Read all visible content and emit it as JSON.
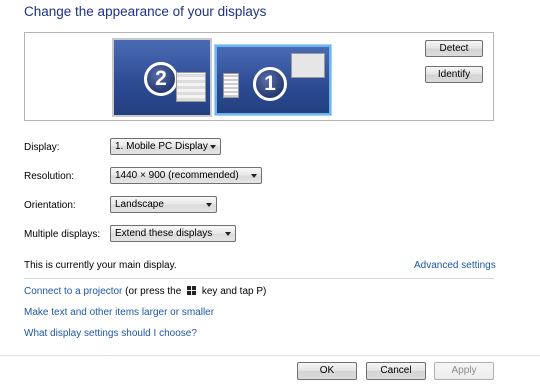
{
  "title": "Change the appearance of your displays",
  "monitors": [
    {
      "number": "2"
    },
    {
      "number": "1"
    }
  ],
  "buttons": {
    "detect": "Detect",
    "identify": "Identify"
  },
  "fields": {
    "display": {
      "label": "Display:",
      "value": "1. Mobile PC Display"
    },
    "resolution": {
      "label": "Resolution:",
      "value": "1440 × 900 (recommended)"
    },
    "orientation": {
      "label": "Orientation:",
      "value": "Landscape"
    },
    "multiple": {
      "label": "Multiple displays:",
      "value": "Extend these displays"
    }
  },
  "status": {
    "main_display": "This is currently your main display.",
    "advanced": "Advanced settings"
  },
  "links": {
    "projector_link": "Connect to a projector",
    "projector_text_a": "(or press the",
    "projector_text_b": "key and tap P)",
    "larger": "Make text and other items larger or smaller",
    "which": "What display settings should I choose?"
  },
  "footer": {
    "ok": "OK",
    "cancel": "Cancel",
    "apply": "Apply"
  }
}
